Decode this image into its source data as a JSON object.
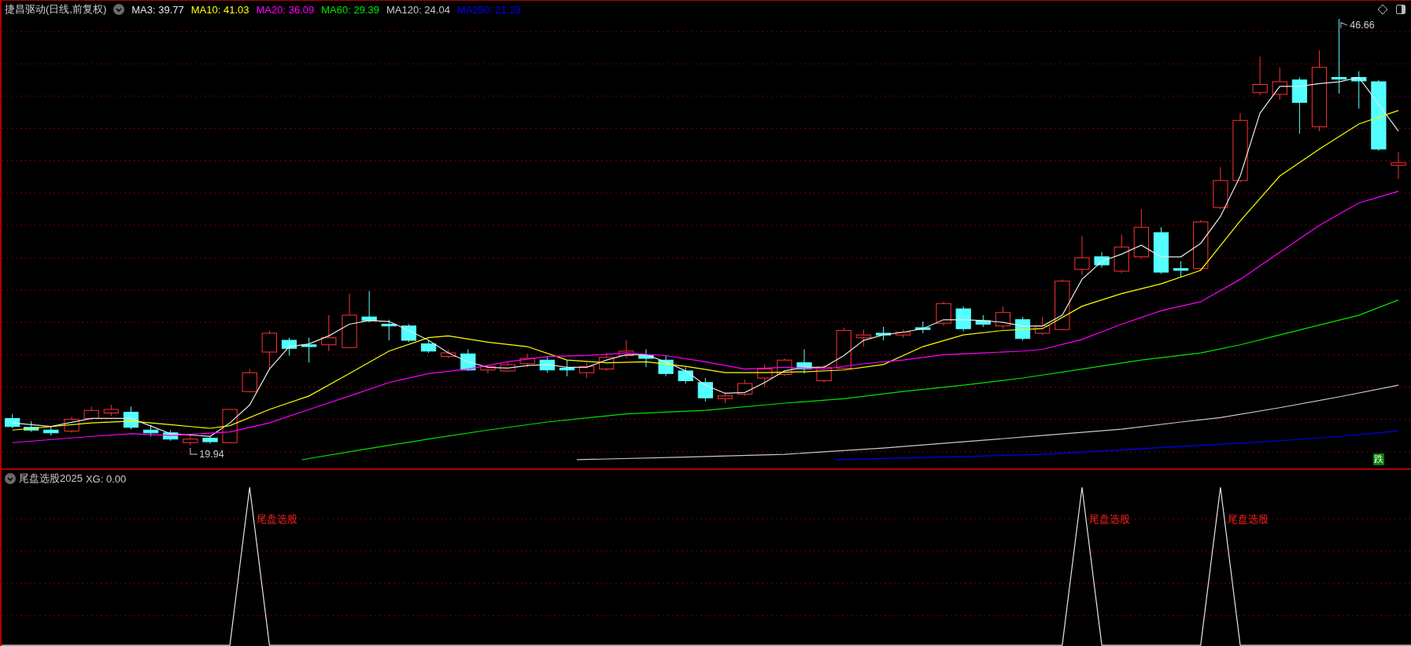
{
  "main_panel": {
    "title": "捷昌驱动(日线,前复权)",
    "indicators": [
      {
        "label": "MA3: 39.77",
        "color": "#e6e6e6"
      },
      {
        "label": "MA10: 41.03",
        "color": "#ffff00"
      },
      {
        "label": "MA20: 36.09",
        "color": "#ff00ff"
      },
      {
        "label": "MA60: 29.39",
        "color": "#00e600"
      },
      {
        "label": "MA120: 24.04",
        "color": "#c8c8c8"
      },
      {
        "label": "MA250: 21.23",
        "color": "#0000ff"
      }
    ],
    "high_label": "46.66",
    "low_label": "19.94",
    "signal_badge": "跌"
  },
  "indicator_panel": {
    "title": "尾盘选股2025",
    "value": "XG: 0.00",
    "signal_labels": [
      "尾盘选股",
      "尾盘选股",
      "尾盘选股"
    ]
  }
}
